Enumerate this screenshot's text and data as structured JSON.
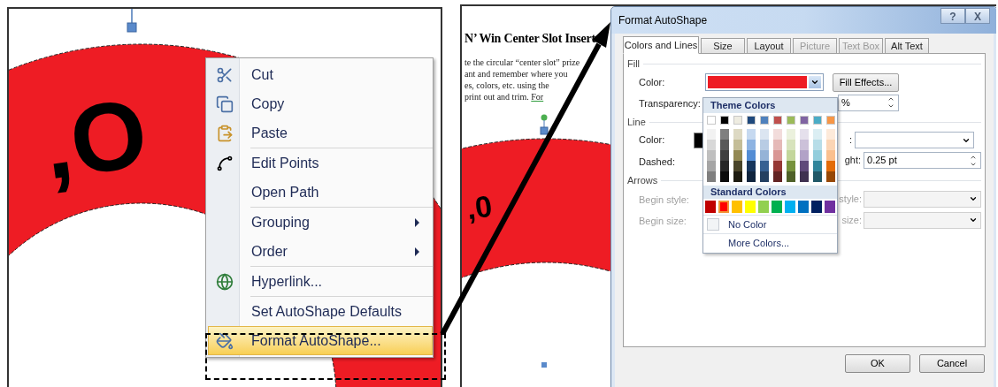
{
  "left_panel": {
    "ring_text": ",O",
    "context_menu": {
      "groups": [
        [
          {
            "label": "Cut",
            "submenu": false,
            "selected": false
          },
          {
            "label": "Copy",
            "submenu": false,
            "selected": false
          },
          {
            "label": "Paste",
            "submenu": false,
            "selected": false
          }
        ],
        [
          {
            "label": "Edit Points",
            "submenu": false,
            "selected": false
          },
          {
            "label": "Open Path",
            "submenu": false,
            "selected": false
          }
        ],
        [
          {
            "label": "Grouping",
            "submenu": true,
            "selected": false
          },
          {
            "label": "Order",
            "submenu": true,
            "selected": false
          }
        ],
        [
          {
            "label": "Hyperlink...",
            "submenu": false,
            "selected": false
          }
        ],
        [
          {
            "label": "Set AutoShape Defaults",
            "submenu": false,
            "selected": false
          },
          {
            "label": "Format AutoShape...",
            "submenu": false,
            "selected": true
          }
        ]
      ]
    }
  },
  "right_panel": {
    "document": {
      "heading": "N’ Win Center Slot Insert",
      "lines": [
        {
          "text": "te the circular “center slot” prize"
        },
        {
          "text": "ant and remember where you"
        },
        {
          "text": "es, colors, etc. using the"
        },
        {
          "text": "print out and trim.",
          "link": "For"
        }
      ],
      "ring_text": ",0"
    },
    "dialog": {
      "title": "Format AutoShape",
      "title_buttons": [
        "?",
        "X"
      ],
      "tabs": [
        {
          "label": "Colors and Lines",
          "selected": true,
          "disabled": false
        },
        {
          "label": "Size",
          "selected": false,
          "disabled": false
        },
        {
          "label": "Layout",
          "selected": false,
          "disabled": false
        },
        {
          "label": "Picture",
          "selected": false,
          "disabled": true
        },
        {
          "label": "Text Box",
          "selected": false,
          "disabled": true
        },
        {
          "label": "Alt Text",
          "selected": false,
          "disabled": false
        }
      ],
      "fill": {
        "heading": "Fill",
        "color_label": "Color:",
        "color": "#ee1c24",
        "fill_effects": "Fill Effects...",
        "transparency_label": "Transparency:",
        "transparency_value": "%"
      },
      "line": {
        "heading": "Line",
        "color_label": "Color:",
        "color": "#000000",
        "right_label": ":",
        "dashed_label": "Dashed:",
        "weight_label": "ght:",
        "weight_value": "0.25 pt"
      },
      "arrows": {
        "heading": "Arrows",
        "disabled": true,
        "begin_style": "Begin style:",
        "begin_size": "Begin size:",
        "end_style": "style:",
        "end_size": "size:"
      },
      "color_popup": {
        "theme_heading": "Theme Colors",
        "theme_colors": [
          {
            "color": "#ffffff",
            "shades": [
              {
                "color": "#f2f2f2"
              },
              {
                "color": "#d8d8d8"
              },
              {
                "color": "#bfbfbf"
              },
              {
                "color": "#a5a5a5"
              },
              {
                "color": "#7f7f7f"
              }
            ]
          },
          {
            "color": "#000000",
            "shades": [
              {
                "color": "#7f7f7f"
              },
              {
                "color": "#595959"
              },
              {
                "color": "#3f3f3f"
              },
              {
                "color": "#262626"
              },
              {
                "color": "#0c0c0c"
              }
            ]
          },
          {
            "color": "#eeece1",
            "shades": [
              {
                "color": "#ddd9c3"
              },
              {
                "color": "#c4bd97"
              },
              {
                "color": "#938953"
              },
              {
                "color": "#494429"
              },
              {
                "color": "#1d1b10"
              }
            ]
          },
          {
            "color": "#1f497d",
            "shades": [
              {
                "color": "#c6d9f0"
              },
              {
                "color": "#8db3e2"
              },
              {
                "color": "#548dd4"
              },
              {
                "color": "#17365d"
              },
              {
                "color": "#0f243e"
              }
            ]
          },
          {
            "color": "#4f81bd",
            "shades": [
              {
                "color": "#dbe5f1"
              },
              {
                "color": "#b8cce4"
              },
              {
                "color": "#95b3d7"
              },
              {
                "color": "#366092"
              },
              {
                "color": "#244061"
              }
            ]
          },
          {
            "color": "#c0504d",
            "shades": [
              {
                "color": "#f2dcdb"
              },
              {
                "color": "#e5b9b7"
              },
              {
                "color": "#d99694"
              },
              {
                "color": "#953734"
              },
              {
                "color": "#632423"
              }
            ]
          },
          {
            "color": "#9bbb59",
            "shades": [
              {
                "color": "#ebf1dd"
              },
              {
                "color": "#d7e3bc"
              },
              {
                "color": "#c3d69b"
              },
              {
                "color": "#76923c"
              },
              {
                "color": "#4f6128"
              }
            ]
          },
          {
            "color": "#8064a2",
            "shades": [
              {
                "color": "#e5e0ec"
              },
              {
                "color": "#ccc1d9"
              },
              {
                "color": "#b2a2c7"
              },
              {
                "color": "#5f497a"
              },
              {
                "color": "#3f3151"
              }
            ]
          },
          {
            "color": "#4bacc6",
            "shades": [
              {
                "color": "#dbeef3"
              },
              {
                "color": "#b7dde8"
              },
              {
                "color": "#92cddc"
              },
              {
                "color": "#31859b"
              },
              {
                "color": "#205867"
              }
            ]
          },
          {
            "color": "#f79646",
            "shades": [
              {
                "color": "#fdeada"
              },
              {
                "color": "#fbd5b5"
              },
              {
                "color": "#fac08f"
              },
              {
                "color": "#e36c09"
              },
              {
                "color": "#974806"
              }
            ]
          }
        ],
        "standard_heading": "Standard Colors",
        "standard_colors": [
          {
            "color": "#c00000",
            "selected": false
          },
          {
            "color": "#ff0000",
            "selected": true
          },
          {
            "color": "#ffc000",
            "selected": false
          },
          {
            "color": "#ffff00",
            "selected": false
          },
          {
            "color": "#92d050",
            "selected": false
          },
          {
            "color": "#00b050",
            "selected": false
          },
          {
            "color": "#00b0f0",
            "selected": false
          },
          {
            "color": "#0070c0",
            "selected": false
          },
          {
            "color": "#002060",
            "selected": false
          },
          {
            "color": "#7030a0",
            "selected": false
          }
        ],
        "no_color": "No Color",
        "more_colors": "More Colors..."
      },
      "buttons": [
        "OK",
        "Cancel"
      ]
    }
  }
}
